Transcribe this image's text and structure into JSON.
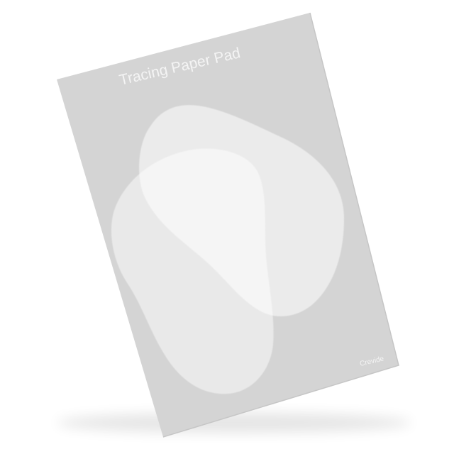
{
  "product": {
    "title": "Tracing Paper Pad",
    "brand": "Crevide"
  },
  "colors": {
    "background": "#ffffff",
    "pad": "#d4d4d4",
    "pad_edge": "#c9c9c9",
    "text": "#f4f4f4",
    "blob": "#ffffff"
  }
}
